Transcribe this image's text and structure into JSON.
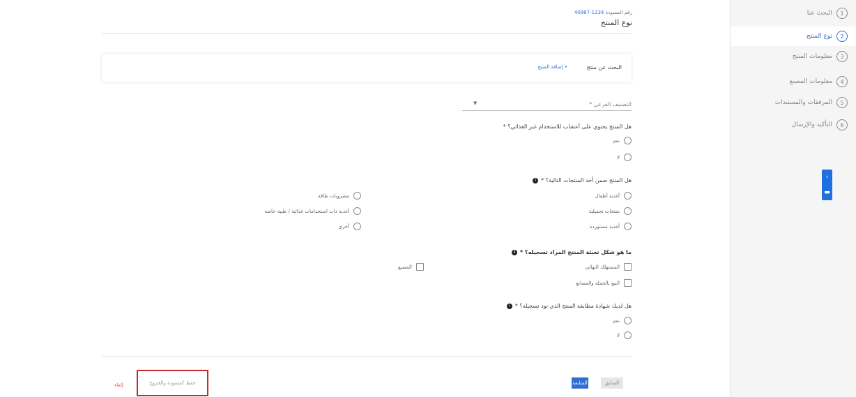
{
  "header": {
    "request_label": "رقم المسودة",
    "request_number": "1234-40987",
    "title": "نوع المنتج"
  },
  "sidebar": {
    "steps": [
      {
        "num": "1",
        "label": "البحث عنا"
      },
      {
        "num": "2",
        "label": "نوع المنتج"
      },
      {
        "num": "3",
        "label": "معلومات المنتج"
      },
      {
        "num": "4",
        "label": "معلومات المصنع"
      },
      {
        "num": "5",
        "label": "المرفقات والمستندات"
      },
      {
        "num": "6",
        "label": "التأكيد والإرسال"
      }
    ]
  },
  "feedback": {
    "icon_top": "chevron-left-icon",
    "icon_bottom": "message-icon"
  },
  "search": {
    "label": "البحث عن منتج",
    "link": "• إضافة المنتج"
  },
  "classification_select": {
    "placeholder": "التصنيف الفرعي *"
  },
  "q1": {
    "text": "هل المنتج يحتوي على أعشاب للاستخدام غير الغذائي؟ *",
    "options": [
      "نعم",
      "لا"
    ]
  },
  "q2": {
    "text": "هل المنتج ضمن أحد المنتجات التالية؟ *",
    "options_right": [
      "أغذية أطفال",
      "منتجات تجميلية",
      "أغذية مستوردة"
    ],
    "options_left": [
      "مشروبات طاقة",
      "أغذية ذات استخدامات غذائية / طبية خاصة",
      "أخرى"
    ]
  },
  "q3": {
    "text": "ما هو شكل تعبئة المنتج المراد تسجيله؟ *",
    "options_right": [
      "المستهلك النهائي",
      "البيع بالجملة والمصانع"
    ],
    "options_left": [
      "المصنع"
    ]
  },
  "q4": {
    "text": "هل لديك شهادة مطابقة المنتج الذي تود تسجيله؟ *",
    "options": [
      "نعم",
      "لا"
    ]
  },
  "footer": {
    "next": "المتابعة",
    "prev": "السابق",
    "cancel": "إلغاء",
    "save_draft": "حفظ كمسودة والخروج"
  }
}
